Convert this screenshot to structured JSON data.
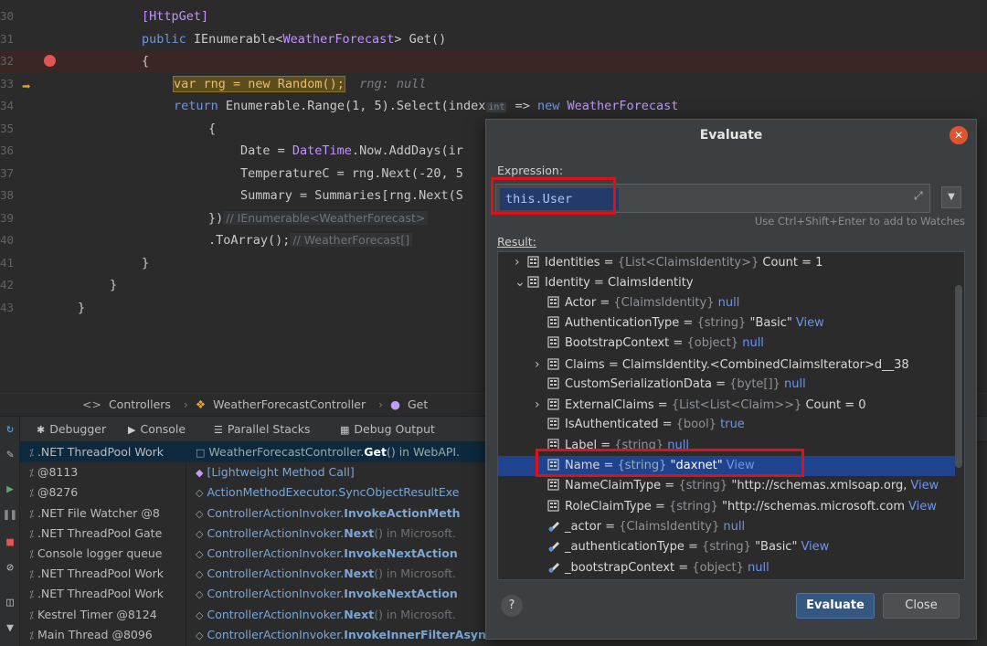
{
  "editor": {
    "lines": [
      {
        "num": "30",
        "segs": [
          [
            "ty",
            "[HttpGet]"
          ]
        ],
        "indent": 155
      },
      {
        "num": "31",
        "segs": [
          [
            "kw",
            "public "
          ],
          [
            "an",
            "IEnumerable<"
          ],
          [
            "ty",
            "WeatherForecast"
          ],
          [
            "an",
            "> Get()"
          ]
        ],
        "indent": 155
      },
      {
        "num": "32",
        "segs": [
          [
            "an",
            "{"
          ]
        ],
        "indent": 155,
        "breakpoint": true
      },
      {
        "num": "33",
        "segs": [
          [
            "exec",
            "var rng = new Random();"
          ],
          [
            "hint",
            "  rng: null"
          ]
        ],
        "indent": 190,
        "current": true
      },
      {
        "num": "34",
        "segs": [
          [
            "kw",
            "return "
          ],
          [
            "an",
            "Enumerable.Range(1, 5).Select(index"
          ],
          [
            "inlay",
            "int"
          ],
          [
            "an",
            " => "
          ],
          [
            "kw",
            "new "
          ],
          [
            "ty",
            "WeatherForecast"
          ]
        ],
        "indent": 190
      },
      {
        "num": "35",
        "segs": [
          [
            "an",
            "{"
          ]
        ],
        "indent": 228
      },
      {
        "num": "36",
        "segs": [
          [
            "an",
            "Date = "
          ],
          [
            "ty",
            "DateTime"
          ],
          [
            "an",
            ".Now.AddDays(ir"
          ]
        ],
        "indent": 263
      },
      {
        "num": "37",
        "segs": [
          [
            "an",
            "TemperatureC = rng.Next(-20, 5"
          ]
        ],
        "indent": 263
      },
      {
        "num": "38",
        "segs": [
          [
            "an",
            "Summary = Summaries[rng.Next(S"
          ]
        ],
        "indent": 263
      },
      {
        "num": "39",
        "segs": [
          [
            "an",
            "})"
          ],
          [
            "cm",
            "// IEnumerable<WeatherForecast>"
          ]
        ],
        "indent": 228
      },
      {
        "num": "40",
        "segs": [
          [
            "an",
            ".ToArray();"
          ],
          [
            "cm",
            "// WeatherForecast[]"
          ]
        ],
        "indent": 228
      },
      {
        "num": "41",
        "segs": [
          [
            "an",
            "}"
          ]
        ],
        "indent": 155
      },
      {
        "num": "42",
        "segs": [
          [
            "an",
            "}"
          ]
        ],
        "indent": 120
      },
      {
        "num": "43",
        "segs": [
          [
            "an",
            "}"
          ]
        ],
        "indent": 85
      }
    ]
  },
  "breadcrumb": {
    "items": [
      "Controllers",
      "WeatherForecastController",
      "Get"
    ]
  },
  "debugger": {
    "tabs": [
      "Debugger",
      "Console",
      "Parallel Stacks",
      "Debug Output"
    ],
    "threads": [
      ".NET ThreadPool Work",
      "@8113",
      "@8276",
      ".NET File Watcher @8",
      ".NET ThreadPool Gate",
      "Console logger queue",
      ".NET ThreadPool Work",
      ".NET ThreadPool Work",
      "Kestrel Timer @8124",
      "Main Thread @8096"
    ],
    "frames": [
      {
        "base": "WeatherForecastController.",
        "method": "Get",
        "info": "() in WebAPI."
      },
      {
        "base": "[Lightweight Method Call]",
        "method": "",
        "info": ""
      },
      {
        "base": "ActionMethodExecutor.SyncObjectResultExe",
        "method": "",
        "info": ""
      },
      {
        "base": "ControllerActionInvoker.",
        "method": "InvokeActionMeth",
        "info": ""
      },
      {
        "base": "ControllerActionInvoker.",
        "method": "Next",
        "info": "() in Microsoft."
      },
      {
        "base": "ControllerActionInvoker.",
        "method": "InvokeNextAction",
        "info": ""
      },
      {
        "base": "ControllerActionInvoker.",
        "method": "Next",
        "info": "() in Microsoft."
      },
      {
        "base": "ControllerActionInvoker.",
        "method": "InvokeNextAction",
        "info": ""
      },
      {
        "base": "ControllerActionInvoker.",
        "method": "Next",
        "info": "() in Microsoft."
      },
      {
        "base": "ControllerActionInvoker.",
        "method": "InvokeInnerFilterAsync(",
        "info": ""
      }
    ]
  },
  "dialog": {
    "title": "Evaluate",
    "expression_label": "Expression:",
    "expression_value": "this.User",
    "watch_hint": "Use Ctrl+Shift+Enter to add to Watches",
    "result_label": "Result:",
    "evaluate_button": "Evaluate",
    "close_button": "Close",
    "help_button": "?",
    "tree": [
      {
        "level": 1,
        "arrow": "right",
        "icon": "field",
        "name": "Identities",
        "type": "{List<ClaimsIdentity>}",
        "value": "Count = 1"
      },
      {
        "level": 1,
        "arrow": "down",
        "icon": "field",
        "name": "Identity",
        "type": "",
        "value": "ClaimsIdentity"
      },
      {
        "level": 2,
        "arrow": "",
        "icon": "field",
        "name": "Actor",
        "type": "{ClaimsIdentity}",
        "value": "null",
        "valueKind": "null"
      },
      {
        "level": 2,
        "arrow": "",
        "icon": "field",
        "name": "AuthenticationType",
        "type": "{string}",
        "value": "\"Basic\"",
        "link": "View"
      },
      {
        "level": 2,
        "arrow": "",
        "icon": "field",
        "name": "BootstrapContext",
        "type": "{object}",
        "value": "null",
        "valueKind": "null"
      },
      {
        "level": 2,
        "arrow": "right",
        "icon": "field",
        "name": "Claims",
        "type": "",
        "value": "ClaimsIdentity.<CombinedClaimsIterator>d__38"
      },
      {
        "level": 2,
        "arrow": "",
        "icon": "field",
        "name": "CustomSerializationData",
        "type": "{byte[]}",
        "value": "null",
        "valueKind": "null"
      },
      {
        "level": 2,
        "arrow": "right",
        "icon": "field",
        "name": "ExternalClaims",
        "type": "{List<List<Claim>>}",
        "value": "Count = 0"
      },
      {
        "level": 2,
        "arrow": "",
        "icon": "field",
        "name": "IsAuthenticated",
        "type": "{bool}",
        "value": "true",
        "valueKind": "null"
      },
      {
        "level": 2,
        "arrow": "",
        "icon": "field",
        "name": "Label",
        "type": "{string}",
        "value": "null",
        "valueKind": "null"
      },
      {
        "level": 2,
        "arrow": "",
        "icon": "field",
        "name": "Name",
        "type": "{string}",
        "value": "\"daxnet\"",
        "link": "View",
        "selected": true
      },
      {
        "level": 2,
        "arrow": "",
        "icon": "field",
        "name": "NameClaimType",
        "type": "{string}",
        "value": "\"http://schemas.xmlsoap.org,",
        "link": "View"
      },
      {
        "level": 2,
        "arrow": "",
        "icon": "field",
        "name": "RoleClaimType",
        "type": "{string}",
        "value": "\"http://schemas.microsoft.com",
        "link": "View"
      },
      {
        "level": 2,
        "arrow": "",
        "icon": "private",
        "name": "_actor",
        "type": "{ClaimsIdentity}",
        "value": "null",
        "valueKind": "null"
      },
      {
        "level": 2,
        "arrow": "",
        "icon": "private",
        "name": "_authenticationType",
        "type": "{string}",
        "value": "\"Basic\"",
        "link": "View"
      },
      {
        "level": 2,
        "arrow": "",
        "icon": "private",
        "name": "_bootstrapContext",
        "type": "{object}",
        "value": "null",
        "valueKind": "null"
      }
    ]
  }
}
